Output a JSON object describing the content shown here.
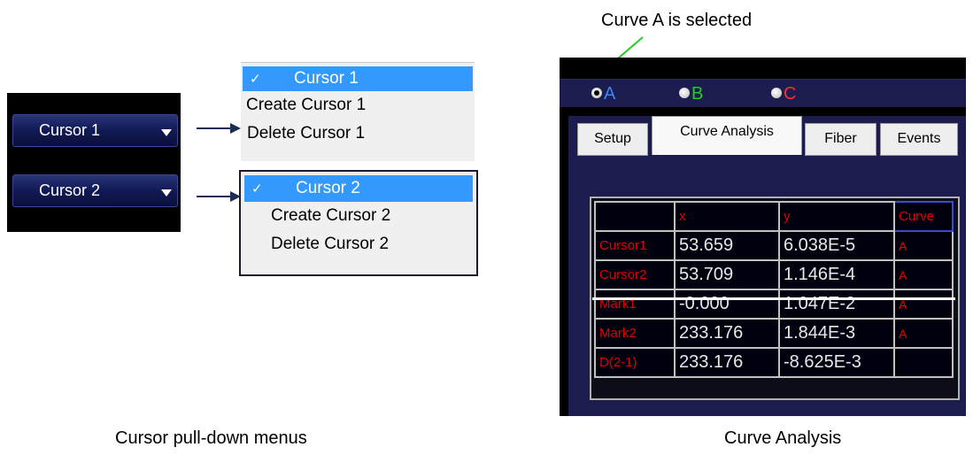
{
  "annotation": {
    "text": "Curve A is selected",
    "color": "#22cc22"
  },
  "cursor_buttons": [
    {
      "label": "Cursor 1"
    },
    {
      "label": "Cursor 2"
    }
  ],
  "menus": [
    {
      "selected": "Cursor 1",
      "check": "✓",
      "items": [
        "Create  Cursor 1",
        "Delete  Cursor 1"
      ]
    },
    {
      "selected": "Cursor 2",
      "check": "✓",
      "items": [
        "Create Cursor 2",
        "Delete  Cursor 2"
      ]
    }
  ],
  "radios": [
    {
      "label": "A",
      "color": "#3388ff",
      "selected": true
    },
    {
      "label": "B",
      "color": "#22cc22",
      "selected": false
    },
    {
      "label": "C",
      "color": "#ee3333",
      "selected": false
    }
  ],
  "tabs": [
    "Setup",
    "Curve Analysis",
    "Fiber",
    "Events"
  ],
  "active_tab": "Curve Analysis",
  "table": {
    "headers": [
      "",
      "x",
      "y",
      "Curve"
    ],
    "rows": [
      [
        "Cursor1",
        "53.659",
        "6.038E-5",
        "A"
      ],
      [
        "Cursor2",
        "53.709",
        "1.146E-4",
        "A"
      ],
      [
        "Mark1",
        "-0.000",
        "1.047E-2",
        "A"
      ],
      [
        "Mark2",
        "233.176",
        "1.844E-3",
        "A"
      ],
      [
        "D(2-1)",
        "233.176",
        "-8.625E-3",
        ""
      ]
    ]
  },
  "captions": {
    "left": "Cursor pull-down menus",
    "right": "Curve Analysis"
  }
}
